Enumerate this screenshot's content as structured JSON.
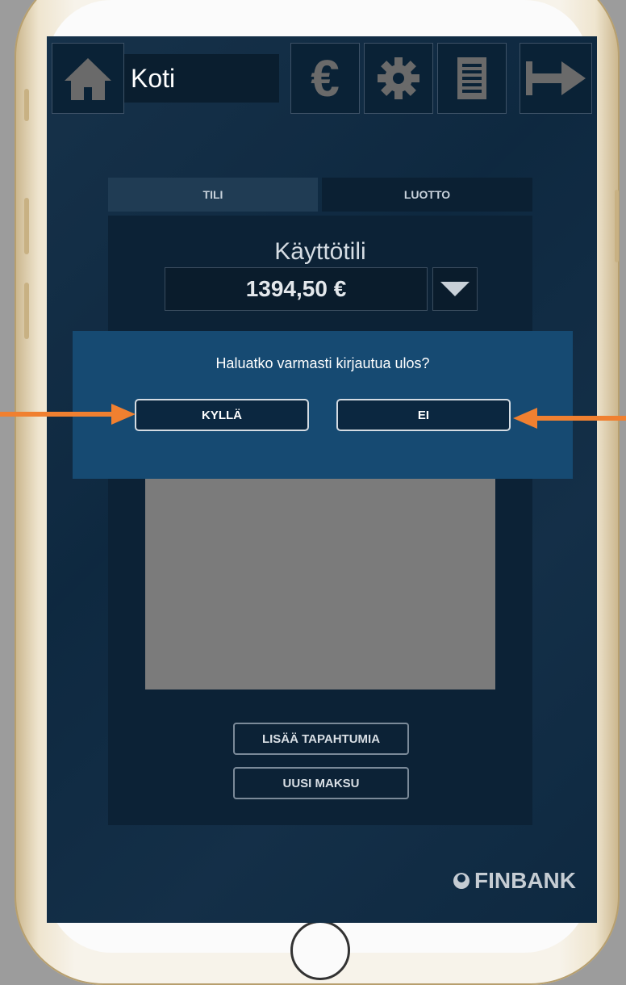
{
  "header": {
    "title": "Koti",
    "icons": [
      "home-icon",
      "euro-icon",
      "gear-icon",
      "document-icon",
      "logout-icon"
    ],
    "euro_symbol": "€"
  },
  "tabs": [
    {
      "label": "TILI",
      "active": true
    },
    {
      "label": "LUOTTO",
      "active": false
    }
  ],
  "account": {
    "name": "Käyttötili",
    "balance": "1394,50 €"
  },
  "actions": {
    "more_transactions": "LISÄÄ TAPAHTUMIA",
    "new_payment": "UUSI MAKSU"
  },
  "dialog": {
    "question": "Haluatko varmasti kirjautua ulos?",
    "yes": "KYLLÄ",
    "no": "EI"
  },
  "brand": {
    "name": "FINBANK"
  },
  "colors": {
    "screen_bg": "#0f2b44",
    "dialog_bg": "#164a72",
    "arrow": "#f08030"
  }
}
